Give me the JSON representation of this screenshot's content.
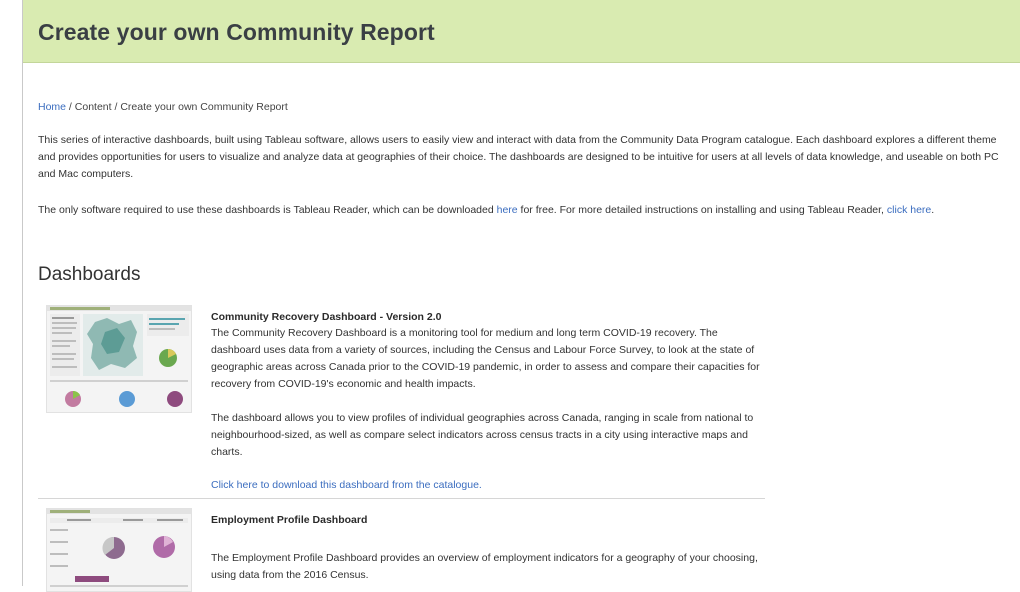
{
  "banner": {
    "title": "Create your own Community Report"
  },
  "breadcrumb": {
    "home": "Home",
    "sep1": " / ",
    "content": "Content",
    "sep2": " / ",
    "current": "Create your own Community Report"
  },
  "intro": {
    "p1": "This series of interactive dashboards, built using Tableau software, allows users to easily view and interact with data from the Community Data Program catalogue. Each dashboard explores a different theme and provides opportunities for users to visualize and analyze data at geographies of their choice. The dashboards are designed to be intuitive for users at all levels of data knowledge, and useable on both PC and Mac computers.",
    "p2_before": "The only software required to use these dashboards is Tableau Reader, which can be downloaded ",
    "p2_link1": "here",
    "p2_middle": " for free. For more detailed instructions on installing and using Tableau Reader, ",
    "p2_link2": "click here",
    "p2_after": "."
  },
  "dashboards": {
    "heading": "Dashboards",
    "items": [
      {
        "title": "Community Recovery Dashboard - Version 2.0",
        "desc1": "The Community Recovery Dashboard is a monitoring tool for medium and long term COVID-19 recovery. The dashboard uses data from a variety of sources, including the Census and Labour Force Survey, to look at the state of geographic areas across Canada prior to the COVID-19 pandemic, in order to assess and compare their capacities for recovery from COVID-19's economic and health impacts.",
        "desc2": "The dashboard allows you to view profiles of individual geographies across Canada, ranging in scale from national to neighbourhood-sized, as well as compare select indicators across census tracts in a city using interactive maps and charts.",
        "link": "Click here to download this dashboard from the catalogue."
      },
      {
        "title": "Employment Profile Dashboard",
        "desc1": "The Employment Profile Dashboard provides an overview of employment indicators for a geography of your choosing, using data from the 2016 Census."
      }
    ]
  }
}
